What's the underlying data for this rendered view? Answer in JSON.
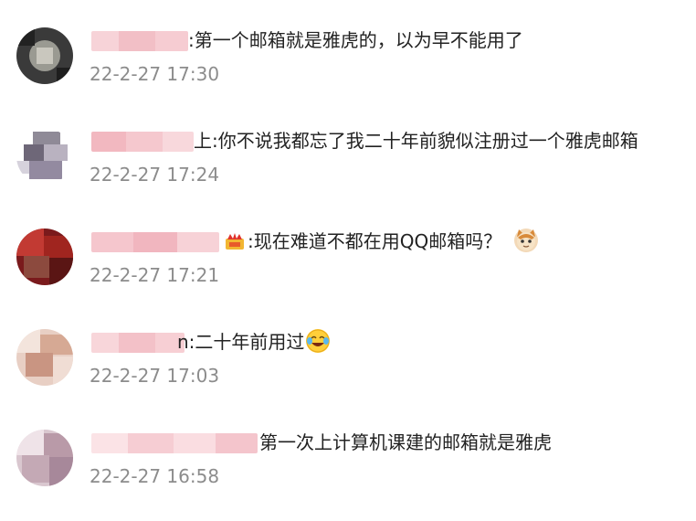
{
  "comments": [
    {
      "text": ":第一个邮箱就是雅虎的，以为早不能用了",
      "time": "22-2-27 17:30"
    },
    {
      "text": "上:你不说我都忘了我二十年前貌似注册过一个雅虎邮箱",
      "time": "22-2-27 17:24"
    },
    {
      "text": ":现在难道不都在用QQ邮箱吗？",
      "time": "22-2-27 17:21"
    },
    {
      "text": "n:二十年前用过",
      "time": "22-2-27 17:03"
    },
    {
      "text": "第一次上计算机课建的邮箱就是雅虎",
      "time": "22-2-27 16:58"
    }
  ],
  "colors": {
    "text": "#222222",
    "timestamp": "#8c8c8c",
    "username_blur": "#f4c4cb"
  },
  "icons": [
    "crown-badge-icon",
    "cat-emoji-icon",
    "laugh-cry-emoji-icon"
  ]
}
